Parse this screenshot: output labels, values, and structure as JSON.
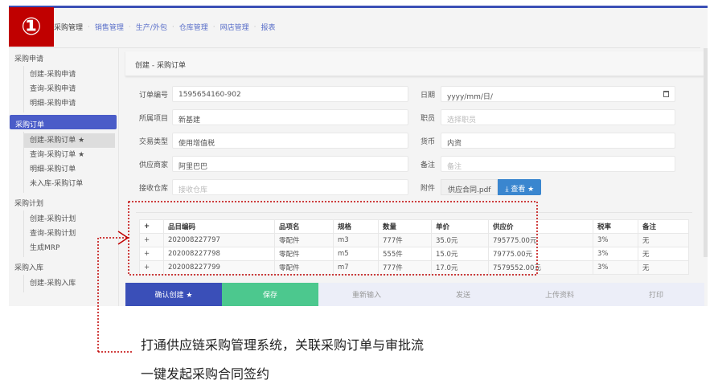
{
  "badge": "①",
  "nav": {
    "items": [
      "采购管理",
      "销售管理",
      "生产/外包",
      "仓库管理",
      "网店管理",
      "报表"
    ]
  },
  "sidebar": {
    "groups": [
      {
        "label": "采购申请",
        "items": [
          "创建-采购申请",
          "查询-采购申请",
          "明细-采购申请"
        ]
      },
      {
        "label": "采购订单",
        "items": [
          "创建-采购订单 ★",
          "查询-采购订单 ★",
          "明细-采购订单",
          "未入库-采购订单"
        ]
      },
      {
        "label": "采购计划",
        "items": [
          "创建-采购计划",
          "查询-采购计划",
          "生成MRP"
        ]
      },
      {
        "label": "采购入库",
        "items": [
          "创建-采购入库"
        ]
      }
    ]
  },
  "page_title": "创建 - 采购订单",
  "form": {
    "order_no": {
      "label": "订单编号",
      "value": "1595654160-902"
    },
    "project": {
      "label": "所属项目",
      "value": "新基建"
    },
    "trade_type": {
      "label": "交易类型",
      "value": "使用增值税"
    },
    "supplier": {
      "label": "供应商家",
      "value": "阿里巴巴"
    },
    "warehouse": {
      "label": "接收仓库",
      "placeholder": "接收仓库"
    },
    "date": {
      "label": "日期",
      "value": "yyyy/mm/日/"
    },
    "staff": {
      "label": "职员",
      "placeholder": "选择职员"
    },
    "currency": {
      "label": "货币",
      "value": "内资"
    },
    "remark": {
      "label": "备注",
      "placeholder": "备注"
    },
    "attachment": {
      "label": "附件",
      "file": "供应合同.pdf",
      "button": "查看 ★"
    }
  },
  "table": {
    "headers": [
      "+",
      "品目编码",
      "品项名",
      "规格",
      "数量",
      "单价",
      "供应价",
      "税率",
      "备注"
    ],
    "rows": [
      [
        "+",
        "202008227797",
        "零配件",
        "m3",
        "777件",
        "35.0元",
        "795775.00元",
        "3%",
        "无"
      ],
      [
        "+",
        "202008227798",
        "零配件",
        "m5",
        "555件",
        "15.0元",
        "79775.00元",
        "3%",
        "无"
      ],
      [
        "+",
        "202008227799",
        "零配件",
        "m7",
        "777件",
        "17.0元",
        "7579552.00元",
        "3%",
        "无"
      ]
    ]
  },
  "buttons": [
    "确认创建 ★",
    "保存",
    "重新输入",
    "发送",
    "上传资料",
    "打印"
  ],
  "annotation": {
    "line1": "打通供应链采购管理系统，关联采购订单与审批流",
    "line2": "一键发起采购合同签约"
  },
  "colors": {
    "accent": "#3b4fb6",
    "badge": "#c00000",
    "save": "#4cc88e",
    "annotation": "#c00000"
  }
}
